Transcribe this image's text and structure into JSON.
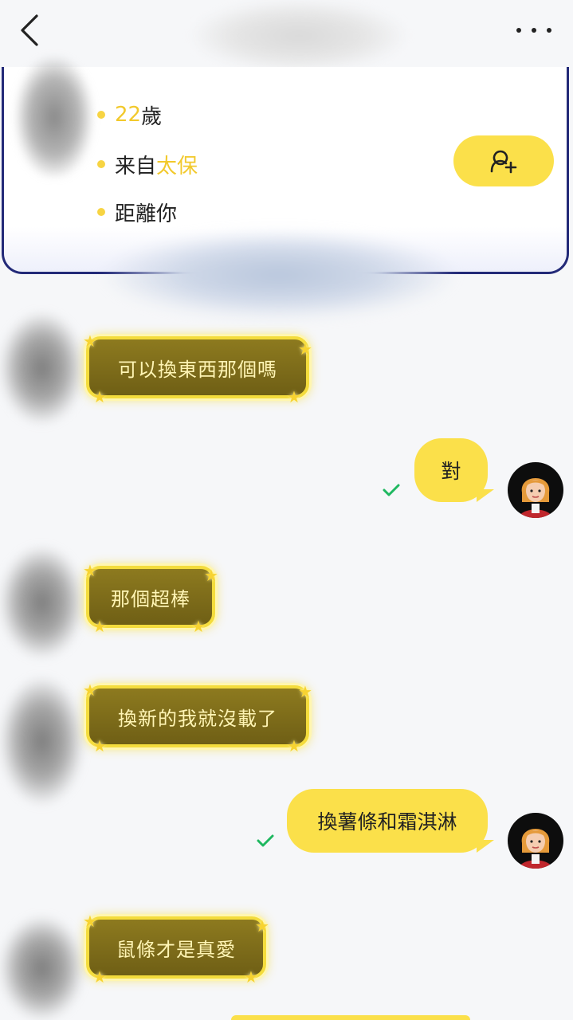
{
  "profile": {
    "age_number": "22",
    "age_unit": "歲",
    "from_prefix": "来自",
    "from_place": "太保",
    "distance_label": "距離你"
  },
  "messages": {
    "m1": "可以換東西那個嗎",
    "m2": "對",
    "m3": "那個超棒",
    "m4": "換新的我就沒載了",
    "m5": "換薯條和霜淇淋",
    "m6": "鼠條才是真愛"
  },
  "colors": {
    "accent_yellow": "#fbe04a",
    "card_border": "#232a78",
    "highlight_text": "#f2c92c",
    "check_green": "#1fb860"
  }
}
